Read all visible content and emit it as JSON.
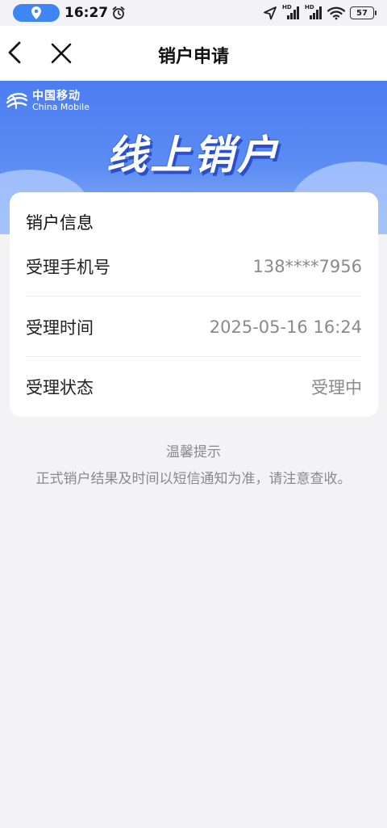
{
  "status_bar": {
    "time": "16:27",
    "hd_label_1": "HD",
    "hd_label_2": "HD",
    "battery": "57"
  },
  "nav": {
    "title": "销户申请"
  },
  "banner": {
    "brand_cn": "中国移动",
    "brand_en": "China Mobile",
    "title": "线上销户"
  },
  "card": {
    "title": "销户信息",
    "rows": [
      {
        "label": "受理手机号",
        "value": "138****7956"
      },
      {
        "label": "受理时间",
        "value": "2025-05-16 16:24"
      },
      {
        "label": "受理状态",
        "value": "受理中"
      }
    ]
  },
  "tips": {
    "title": "温馨提示",
    "text": "正式销户结果及时间以短信通知为准，请注意查收。"
  },
  "colors": {
    "accent": "#3f86f5",
    "banner_top": "#4c7df1",
    "value_gray": "#8a8a8a"
  }
}
